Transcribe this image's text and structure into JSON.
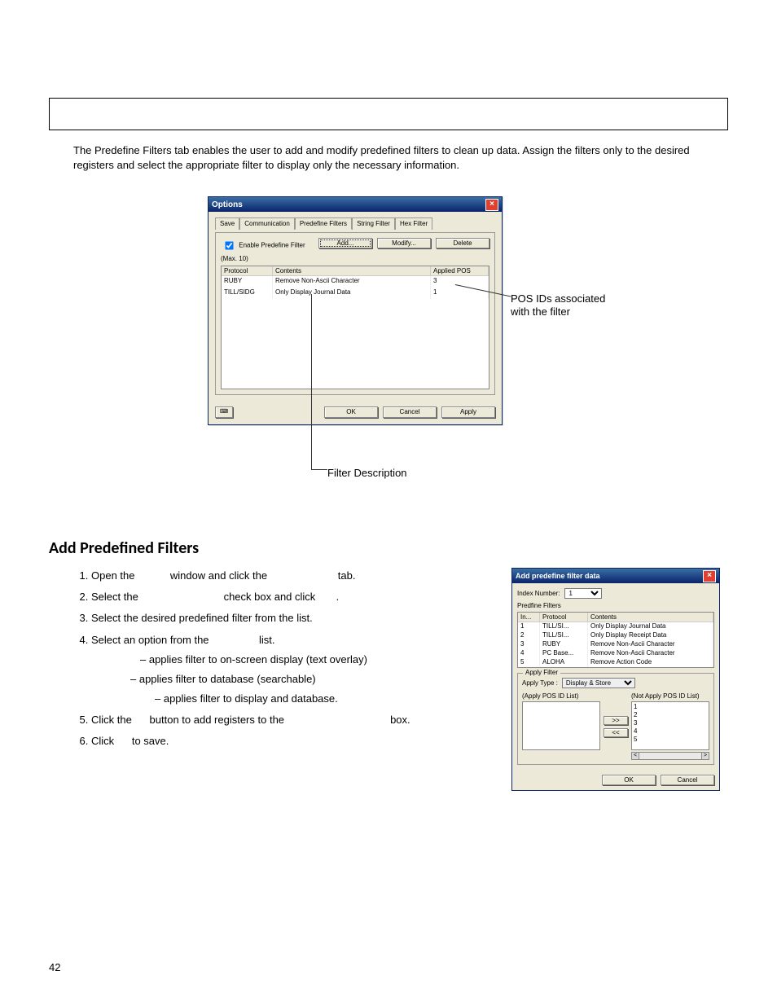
{
  "page_number": "42",
  "intro_text": "The Predefine Filters tab enables the user to add and modify predefined filters to clean up data.  Assign the filters only to the desired registers and select the appropriate filter to display only the necessary information.",
  "heading": "Add Predefined Filters",
  "callouts": {
    "top_right_line1": "POS IDs associated",
    "top_right_line2": "with the filter",
    "bottom": "Filter Description"
  },
  "steps": {
    "s1a": "Open the ",
    "s1b": " window and click the ",
    "s1c": " tab.",
    "s2a": "Select the ",
    "s2b": " check box and click ",
    "s2c": ".",
    "s3": "Select the desired predefined filter from the list.",
    "s4a": "Select an option from the ",
    "s4b": " list.",
    "sub1": " – applies filter to on-screen display (text overlay)",
    "sub2": " – applies filter to database (searchable)",
    "sub3": " – applies filter to display and database.",
    "s5a": "Click the ",
    "s5b": " button to add registers to the ",
    "s5c": " box.",
    "s6a": "Click ",
    "s6b": " to save."
  },
  "dlg1": {
    "title": "Options",
    "tabs": {
      "save": "Save",
      "comm": "Communication",
      "pre": "Predefine Filters",
      "str": "String Filter",
      "hex": "Hex Filter"
    },
    "checkbox": "Enable Predefine Filter",
    "max": "(Max. 10)",
    "btn_add": "Add...",
    "btn_modify": "Modify...",
    "btn_delete": "Delete",
    "col_protocol": "Protocol",
    "col_contents": "Contents",
    "col_applied": "Applied POS",
    "rows": [
      {
        "protocol": "RUBY",
        "contents": "Remove Non-Ascii Character",
        "applied": "3"
      },
      {
        "protocol": "TILL/SIDG",
        "contents": "Only Display Journal Data",
        "applied": "1"
      }
    ],
    "btn_ok": "OK",
    "btn_cancel": "Cancel",
    "btn_apply": "Apply"
  },
  "dlg2": {
    "title": "Add predefine filter data",
    "index_label": "Index Number:",
    "index_value": "1",
    "pf_label": "Predfine Filters",
    "col_in": "In...",
    "col_protocol": "Protocol",
    "col_contents": "Contents",
    "rows": [
      {
        "in": "1",
        "proto": "TILL/SI...",
        "cont": "Only Display Journal Data"
      },
      {
        "in": "2",
        "proto": "TILL/SI...",
        "cont": "Only Display Receipt Data"
      },
      {
        "in": "3",
        "proto": "RUBY",
        "cont": "Remove Non-Ascii Character"
      },
      {
        "in": "4",
        "proto": "PC Base...",
        "cont": "Remove Non-Ascii Character"
      },
      {
        "in": "5",
        "proto": "ALOHA",
        "cont": "Remove Action Code"
      }
    ],
    "groupbox": "Apply Filter",
    "apply_type_label": "Apply Type :",
    "apply_type_value": "Display & Store",
    "apply_list_label": "(Apply POS ID List)",
    "notapply_list_label": "(Not Apply POS ID List)",
    "notapply_items": [
      "1",
      "2",
      "3",
      "4",
      "5"
    ],
    "btn_right": ">>",
    "btn_left": "<<",
    "btn_ok": "OK",
    "btn_cancel": "Cancel"
  }
}
